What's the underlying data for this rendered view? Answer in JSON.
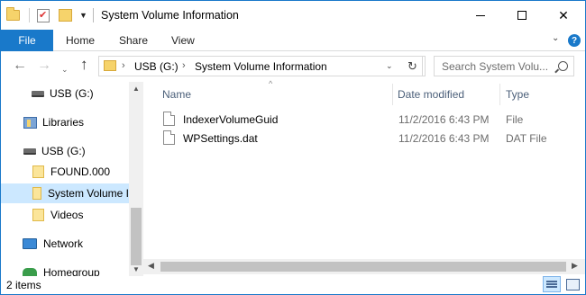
{
  "window": {
    "title": "System Volume Information",
    "caption_buttons": [
      "minimize",
      "maximize",
      "close"
    ]
  },
  "ribbon": {
    "tabs": [
      {
        "label": "File",
        "active": true
      },
      {
        "label": "Home"
      },
      {
        "label": "Share"
      },
      {
        "label": "View"
      }
    ],
    "help_label": "?"
  },
  "navigation": {
    "breadcrumb": [
      "USB (G:)",
      "System Volume Information"
    ],
    "search_placeholder": "Search System Volu..."
  },
  "nav_pane": {
    "items": [
      {
        "label": "USB (G:)",
        "icon": "drive-icon"
      },
      {
        "label": "Libraries",
        "icon": "libraries-icon"
      },
      {
        "label": "USB (G:)",
        "icon": "drive-icon"
      },
      {
        "label": "FOUND.000",
        "icon": "folder-icon"
      },
      {
        "label": "System Volume I",
        "icon": "folder-icon",
        "selected": true
      },
      {
        "label": "Videos",
        "icon": "folder-icon"
      },
      {
        "label": "Network",
        "icon": "network-icon"
      },
      {
        "label": "Homegroup",
        "icon": "homegroup-icon"
      }
    ]
  },
  "file_list": {
    "columns": [
      "Name",
      "Date modified",
      "Type"
    ],
    "rows": [
      {
        "name": "IndexerVolumeGuid",
        "date": "11/2/2016 6:43 PM",
        "type": "File"
      },
      {
        "name": "WPSettings.dat",
        "date": "11/2/2016 6:43 PM",
        "type": "DAT File"
      }
    ]
  },
  "status": {
    "item_count": "2 items"
  },
  "colors": {
    "accent": "#1979ca",
    "selection": "#cce8ff",
    "column_header": "#4c607a"
  }
}
